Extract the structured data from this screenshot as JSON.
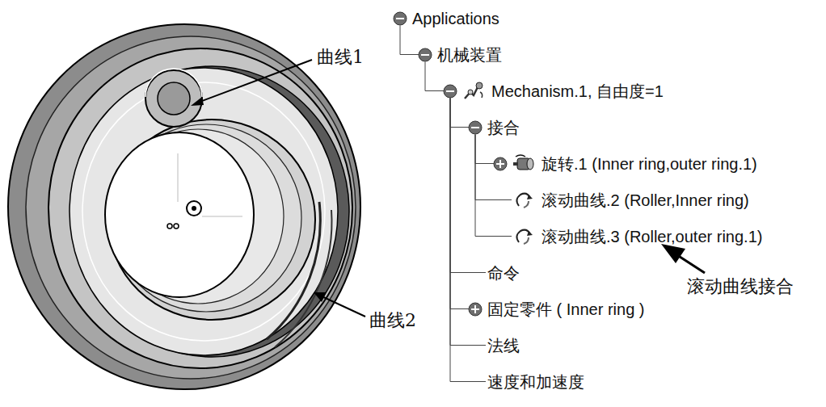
{
  "callouts": [
    {
      "label": "曲线1"
    },
    {
      "label": "曲线2"
    },
    {
      "label": "滚动曲线接合"
    }
  ],
  "tree": [
    {
      "label": "Applications",
      "kind": "expanded",
      "node_type": "folder",
      "children": [
        {
          "label": "机械装置",
          "kind": "expanded",
          "node_type": "folder",
          "children": [
            {
              "label": "Mechanism.1, 自由度=1",
              "kind": "expanded",
              "node_type": "mechanism",
              "children": [
                {
                  "label": "接合",
                  "kind": "expanded",
                  "node_type": "folder",
                  "children": [
                    {
                      "label": "旋转.1 (Inner ring,outer ring.1)",
                      "kind": "collapsed",
                      "node_type": "revolute-joint",
                      "children": []
                    },
                    {
                      "label": "滚动曲线.2 (Roller,Inner ring)",
                      "kind": "leaf",
                      "node_type": "roll-curve-joint",
                      "children": []
                    },
                    {
                      "label": "滚动曲线.3 (Roller,outer ring.1)",
                      "kind": "leaf",
                      "node_type": "roll-curve-joint",
                      "children": []
                    }
                  ]
                },
                {
                  "label": "命令",
                  "kind": "leaf",
                  "node_type": "folder",
                  "children": []
                },
                {
                  "label": "固定零件 ( Inner ring )",
                  "kind": "collapsed",
                  "node_type": "folder",
                  "children": []
                },
                {
                  "label": "法线",
                  "kind": "leaf",
                  "node_type": "folder",
                  "children": []
                },
                {
                  "label": "速度和加速度",
                  "kind": "leaf",
                  "node_type": "folder",
                  "children": []
                }
              ]
            }
          ]
        }
      ]
    }
  ]
}
